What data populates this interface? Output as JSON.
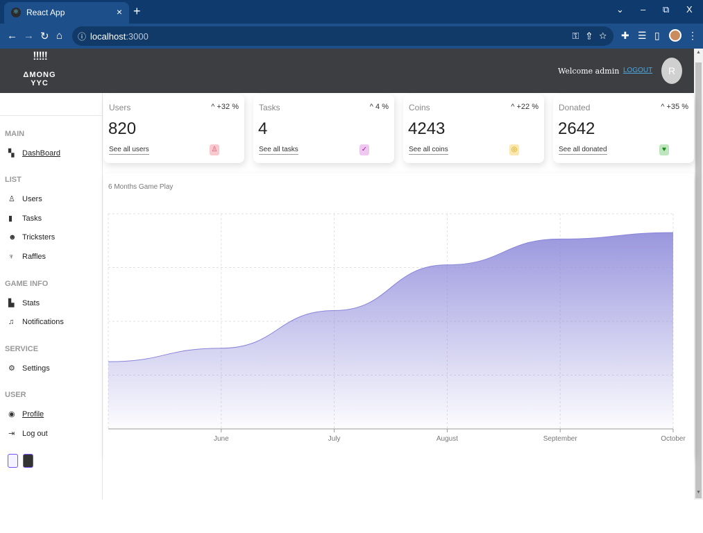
{
  "browser": {
    "tab_title": "React App",
    "tab_close": "×",
    "new_tab": "+",
    "url_host": "localhost",
    "url_port": ":3000",
    "info_icon": "ⓘ",
    "window_controls": [
      "⌄",
      "–",
      "⧉",
      "X"
    ]
  },
  "header": {
    "logo_text": "ΔMONG YYC",
    "welcome": "Welcome admin",
    "logout": "LOGOUT",
    "avatar_initial": "R"
  },
  "sidebar": {
    "sections": [
      {
        "title": "MAIN",
        "items": [
          {
            "label": "DashBoard",
            "icon": "dashboard-icon",
            "link": true
          }
        ]
      },
      {
        "title": "LIST",
        "items": [
          {
            "label": "Users",
            "icon": "user-icon",
            "link": false
          },
          {
            "label": "Tasks",
            "icon": "task-icon",
            "link": false
          },
          {
            "label": "Tricksters",
            "icon": "trickster-icon",
            "link": false
          },
          {
            "label": "Raffles",
            "icon": "trophy-icon",
            "link": false
          }
        ]
      },
      {
        "title": "GAME INFO",
        "items": [
          {
            "label": "Stats",
            "icon": "stats-icon",
            "link": false
          },
          {
            "label": "Notifications",
            "icon": "bell-icon",
            "link": false
          }
        ]
      },
      {
        "title": "SERVICE",
        "items": [
          {
            "label": "Settings",
            "icon": "settings-icon",
            "link": false
          }
        ]
      },
      {
        "title": "USER",
        "items": [
          {
            "label": "Profile",
            "icon": "profile-icon",
            "link": true
          },
          {
            "label": "Log out",
            "icon": "logout-icon",
            "link": false
          }
        ]
      }
    ],
    "theme_colors": [
      "#f4f3ff",
      "#333333"
    ]
  },
  "widgets": [
    {
      "title": "Users",
      "percent": "+32 %",
      "value": "820",
      "link": "See all users",
      "icon": "person-icon",
      "icon_color": "#e05263",
      "icon_bg": "#f8c9cf"
    },
    {
      "title": "Tasks",
      "percent": "4 %",
      "value": "4",
      "link": "See all tasks",
      "icon": "task-check-icon",
      "icon_color": "#a020a8",
      "icon_bg": "#efc8f0"
    },
    {
      "title": "Coins",
      "percent": "+22 %",
      "value": "4243",
      "link": "See all coins",
      "icon": "coin-icon",
      "icon_color": "#d4a000",
      "icon_bg": "#fbe7b0"
    },
    {
      "title": "Donated",
      "percent": "+35 %",
      "value": "2642",
      "link": "See all donated",
      "icon": "donate-icon",
      "icon_color": "#1a8a1a",
      "icon_bg": "#bfe6bf"
    }
  ],
  "chart": {
    "title": "6 Months Game Play"
  },
  "chart_data": {
    "type": "area",
    "title": "6 Months Game Play",
    "categories": [
      "",
      "June",
      "July",
      "August",
      "September",
      "October"
    ],
    "series": [
      {
        "values": [
          1250,
          1500,
          2200,
          3050,
          3530,
          3650
        ]
      }
    ],
    "ylim": [
      0,
      4000
    ],
    "grid": true,
    "color": "#8884d8"
  }
}
